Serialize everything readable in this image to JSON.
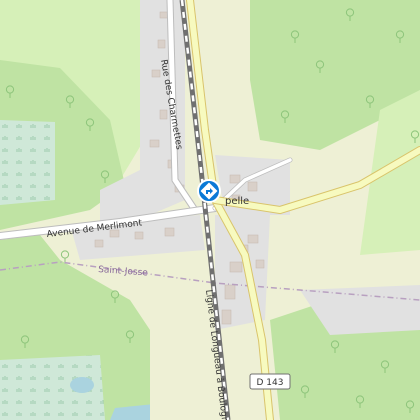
{
  "map": {
    "colors": {
      "forest": "#bfe3a3",
      "meadow": "#d6f0b8",
      "field": "#eef0d5",
      "residential": "#e1e1e1",
      "wetland": "#cfe8d8",
      "water": "#aad3df",
      "building": "#d9d0c9",
      "primary_road": "#f7fabf",
      "primary_road_casing": "#d9c46b",
      "minor_road": "#ffffff",
      "minor_road_casing": "#bdbdbd",
      "railway": "#707070",
      "boundary": "#b8a0c0",
      "poi": "#0a79d6"
    },
    "labels": {
      "rue_des_charmettes": "Rue des Charmettes",
      "avenue_de_merlimont": "Avenue de Merlimont",
      "saint_josse": "Saint-Josse",
      "chapelle_partial": "pelle",
      "ligne": "Ligne de Longueau à Boulogne",
      "road_shield": "D 143"
    },
    "marker": {
      "icon": "directions-diamond-icon"
    }
  }
}
